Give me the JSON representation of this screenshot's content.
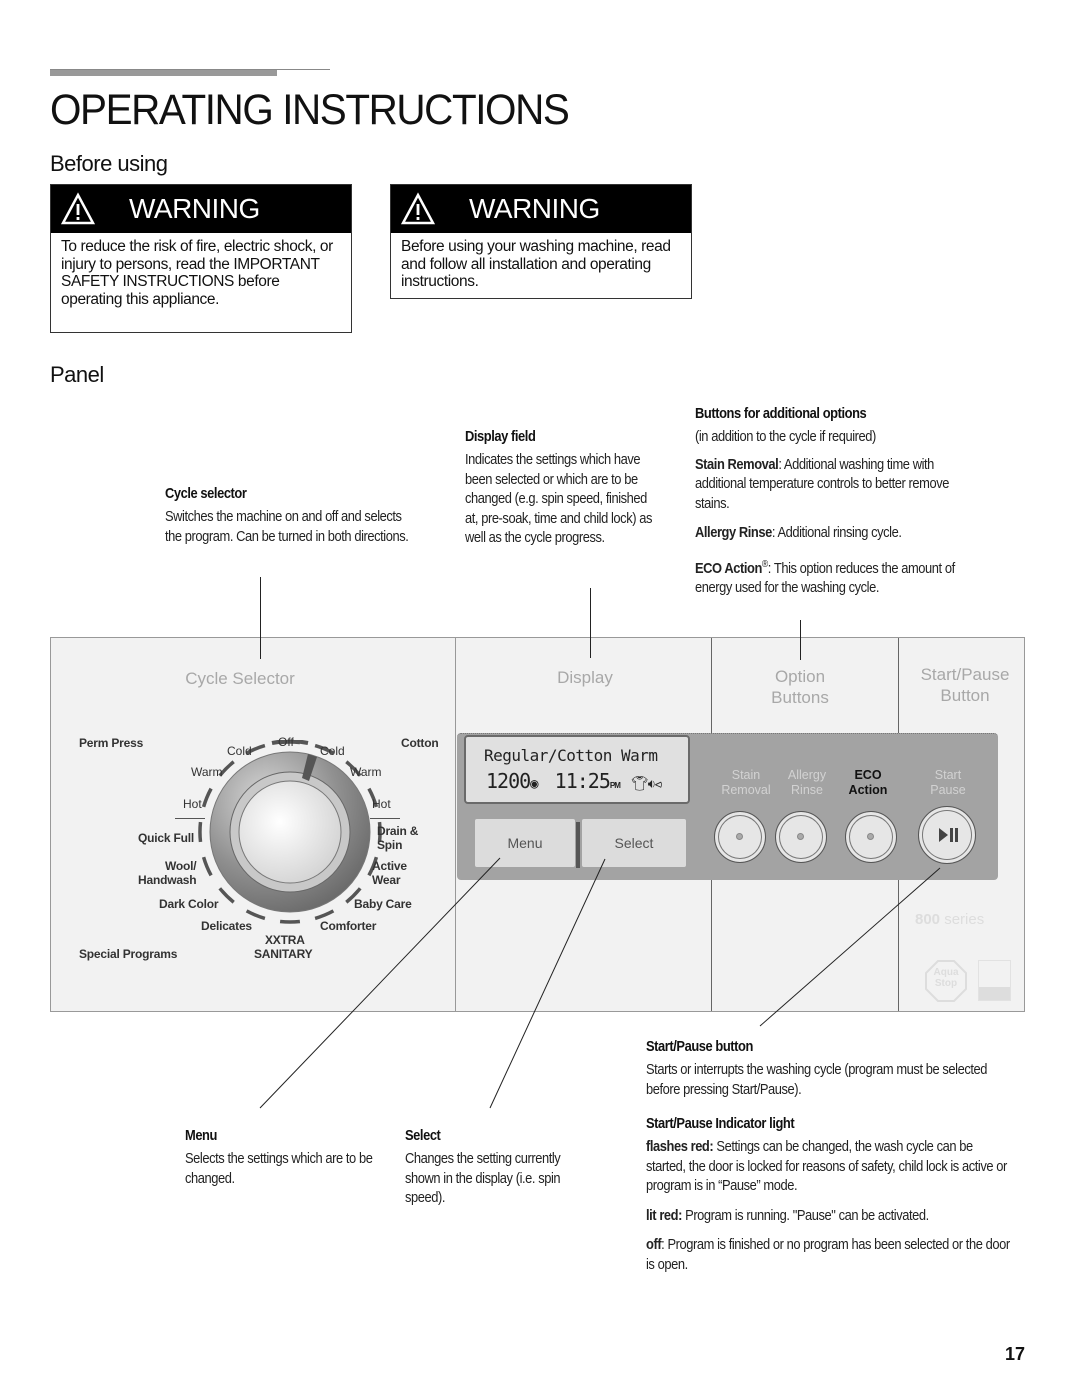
{
  "page": {
    "title": "OPERATING INSTRUCTIONS",
    "page_number": "17"
  },
  "before_using": {
    "heading": "Before using",
    "warnings": [
      {
        "label": "WARNING",
        "icon": "warning-triangle-icon",
        "text": "To reduce the risk of fire, electric shock, or injury to persons, read the IMPORTANT SAFETY INSTRUCTIONS before operating this appliance."
      },
      {
        "label": "WARNING",
        "icon": "warning-triangle-icon",
        "text": "Before using your washing machine, read and follow all installation and operating instructions."
      }
    ]
  },
  "panel_section": {
    "heading": "Panel",
    "callouts": {
      "cycle_selector": {
        "title": "Cycle selector",
        "text": "Switches the machine on and off and selects the program. Can be turned in both directions."
      },
      "display_field": {
        "title": "Display field",
        "text": "Indicates the settings which have been selected or which are to be changed (e.g. spin speed, finished at, pre-soak, time and child lock) as well as the cycle progress."
      },
      "option_buttons": {
        "title": "Buttons for additional options",
        "subtitle": "(in addition to the cycle if required)",
        "items": [
          {
            "name": "Stain Removal",
            "text": ": Additional washing time with additional temperature controls to better remove stains."
          },
          {
            "name": "Allergy Rinse",
            "text": ": Additional rinsing cycle."
          },
          {
            "name": "ECO Action",
            "sup": "®",
            "text": ": This option reduces the amount of energy used for the washing cycle."
          }
        ]
      },
      "menu": {
        "title": "Menu",
        "text": "Selects the settings which are to be changed."
      },
      "select": {
        "title": "Select",
        "text": "Changes the setting currently shown in the display (i.e. spin speed)."
      },
      "start_pause_button": {
        "title": "Start/Pause button",
        "text": "Starts or interrupts the washing cycle (program must be selected before pressing Start/Pause)."
      },
      "start_pause_indicator": {
        "title": "Start/Pause Indicator light",
        "states": [
          {
            "state": "flashes red:",
            "text": " Settings can be changed, the wash cycle can be started, the door is locked for reasons of safety, child lock is active or program is in “Pause” mode."
          },
          {
            "state": "lit red:",
            "text": " Program is running. \"Pause\" can be activated."
          },
          {
            "state": "off",
            "text": ": Program is finished or no program has been selected or the door is open."
          }
        ]
      }
    },
    "machine_panel": {
      "section_titles": {
        "cycle_selector": "Cycle Selector",
        "display": "Display",
        "option_buttons_1": "Option",
        "option_buttons_2": "Buttons",
        "start_pause_1": "Start/Pause",
        "start_pause_2": "Button"
      },
      "dial": {
        "group_left": "Perm Press",
        "group_right": "Cotton",
        "group_bottom": "Special Programs",
        "temps_left": [
          "Cold",
          "Warm",
          "Hot"
        ],
        "off": "Off",
        "temps_right": [
          "Cold",
          "Warm",
          "Hot"
        ],
        "programs_left": [
          "Quick Full",
          "Wool/",
          "Handwash",
          "Dark Color",
          "Delicates"
        ],
        "programs_right": [
          "Drain &",
          "Spin",
          "Active",
          "Wear",
          "Baby Care",
          "Comforter"
        ],
        "program_bottom_1": "XXTRA",
        "program_bottom_2": "SANITARY"
      },
      "lcd": {
        "line1": "Regular/Cotton Warm",
        "spin_speed": "1200",
        "time": "11:25",
        "ampm": "PM"
      },
      "menu_button": "Menu",
      "select_button": "Select",
      "option_buttons": [
        {
          "line1": "Stain",
          "line2": "Removal"
        },
        {
          "line1": "Allergy",
          "line2": "Rinse"
        },
        {
          "line1": "ECO",
          "line2": "Action"
        }
      ],
      "start_button": {
        "line1": "Start",
        "line2": "Pause",
        "icon": "play-pause-icon"
      },
      "series_number": "800",
      "series_label": " series",
      "aquastop_1": "Aqua",
      "aquastop_2": "Stop"
    }
  }
}
